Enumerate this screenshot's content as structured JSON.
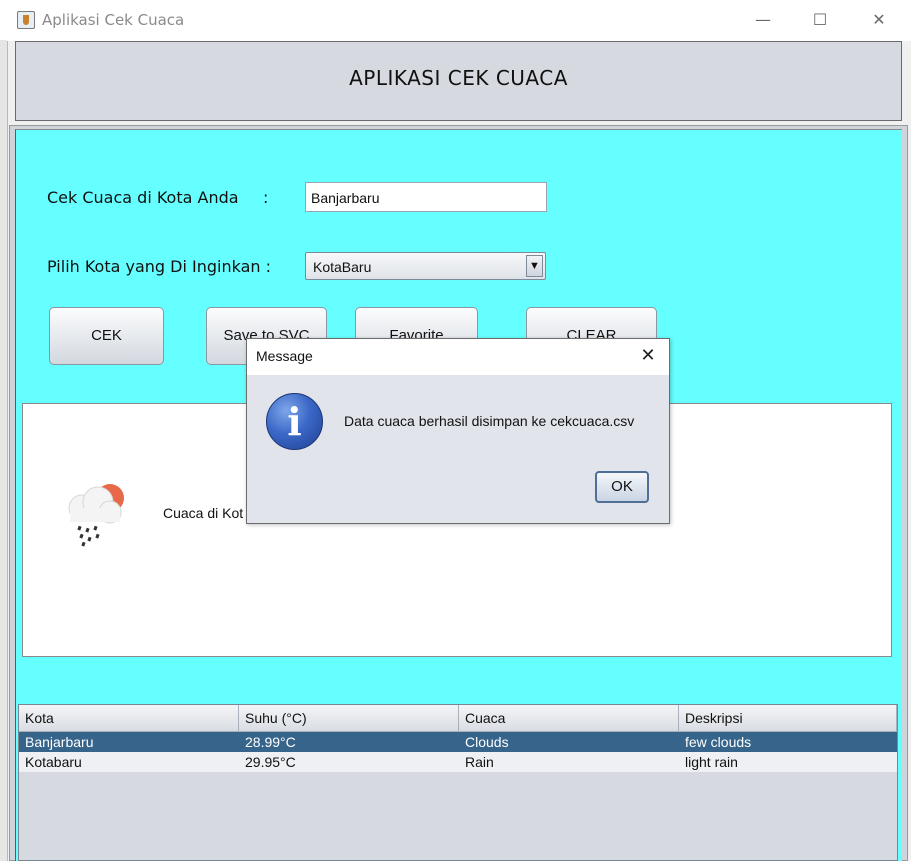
{
  "window": {
    "title": "Aplikasi Cek Cuaca",
    "controls": {
      "minimize": "—",
      "maximize": "☐",
      "close": "✕"
    }
  },
  "header": {
    "title": "APLIKASI CEK CUACA"
  },
  "form": {
    "city_label": "Cek Cuaca di Kota Anda",
    "city_colon": ":",
    "city_value": "Banjarbaru",
    "choose_label": "Pilih Kota yang Di Inginkan :",
    "choose_selected": "KotaBaru"
  },
  "buttons": {
    "cek": "CEK",
    "save": "Save to SVC",
    "favorite": "Favorite",
    "clear": "CLEAR"
  },
  "result": {
    "text": "Cuaca di Kot"
  },
  "table": {
    "headers": [
      "Kota",
      "Suhu (°C)",
      "Cuaca",
      "Deskripsi"
    ],
    "rows": [
      [
        "Banjarbaru",
        "28.99°C",
        "Clouds",
        "few clouds"
      ],
      [
        "Kotabaru",
        "29.95°C",
        "Rain",
        "light rain"
      ]
    ]
  },
  "dialog": {
    "title": "Message",
    "message": "Data cuaca berhasil disimpan ke cekcuaca.csv",
    "ok_label": "OK",
    "icon": "info-icon"
  },
  "colors": {
    "main_bg": "#66ffff",
    "selected_row": "#36648b",
    "header_bg": "#d6d9df"
  }
}
